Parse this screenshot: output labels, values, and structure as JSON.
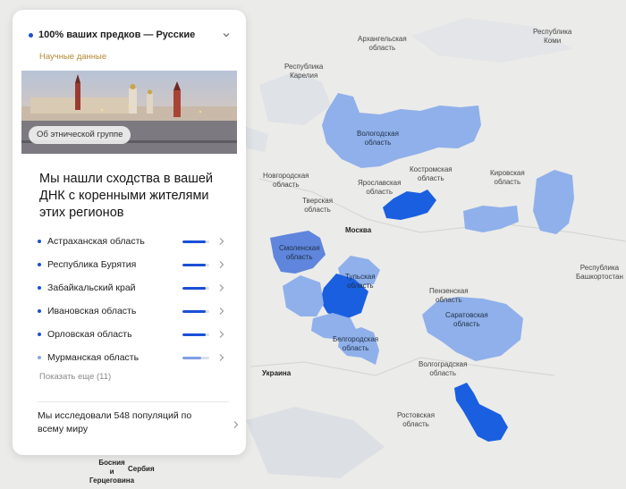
{
  "card": {
    "ancestry_title": "100% ваших предков — Русские",
    "subtitle": "Научные данные",
    "photo_chip": "Об этнической группе",
    "headline": "Мы нашли сходства в вашей ДНК с коренными жителями этих регионов",
    "regions": [
      {
        "name": "Астраханская область",
        "match_fraction": 0.85,
        "bar_color": "#1a4fd6"
      },
      {
        "name": "Республика Бурятия",
        "match_fraction": 0.85,
        "bar_color": "#1a4fd6"
      },
      {
        "name": "Забайкальский край",
        "match_fraction": 0.85,
        "bar_color": "#1a4fd6"
      },
      {
        "name": "Ивановская область",
        "match_fraction": 0.85,
        "bar_color": "#1a4fd6"
      },
      {
        "name": "Орловская область",
        "match_fraction": 0.85,
        "bar_color": "#1a4fd6"
      },
      {
        "name": "Мурманская область",
        "match_fraction": 0.7,
        "bar_color": "#7f9fe3"
      }
    ],
    "show_more": "Показать еще (11)",
    "footer_text": "Мы исследовали 548 популяций по всему миру"
  },
  "map": {
    "labels": {
      "arkhangelsk": "Архангельская\nобласть",
      "komi": "Республика\nКоми",
      "karelia": "Республика\nКарелия",
      "vologda": "Вологодская\nобласть",
      "kostroma": "Костромская\nобласть",
      "novgorod": "Новгородская\nобласть",
      "yaroslavl": "Ярославская\nобласть",
      "kirov": "Кировская\nобласть",
      "tver": "Тверская\nобласть",
      "moscow": "Москва",
      "smolensk": "Смоленская\nобласть",
      "tula": "Тульская\nобласть",
      "bashkortostan": "Республика\nБашкортостан",
      "penza": "Пензенская\nобласть",
      "saratov": "Саратовская\nобласть",
      "belgorod": "Белгородская\nобласть",
      "ukraine": "Украина",
      "volgograd": "Волгоградская\nобласть",
      "rostov": "Ростовская\nобласть",
      "bosnia": "Босния\nи\nГерцеговина",
      "serbia": "Сербия"
    }
  },
  "colors": {
    "strong_region": "#1a5fe0",
    "medium_region": "#5f86dc",
    "light_region": "#8fb0ea",
    "map_land": "#ebebe9",
    "map_water": "#d9dde3"
  }
}
